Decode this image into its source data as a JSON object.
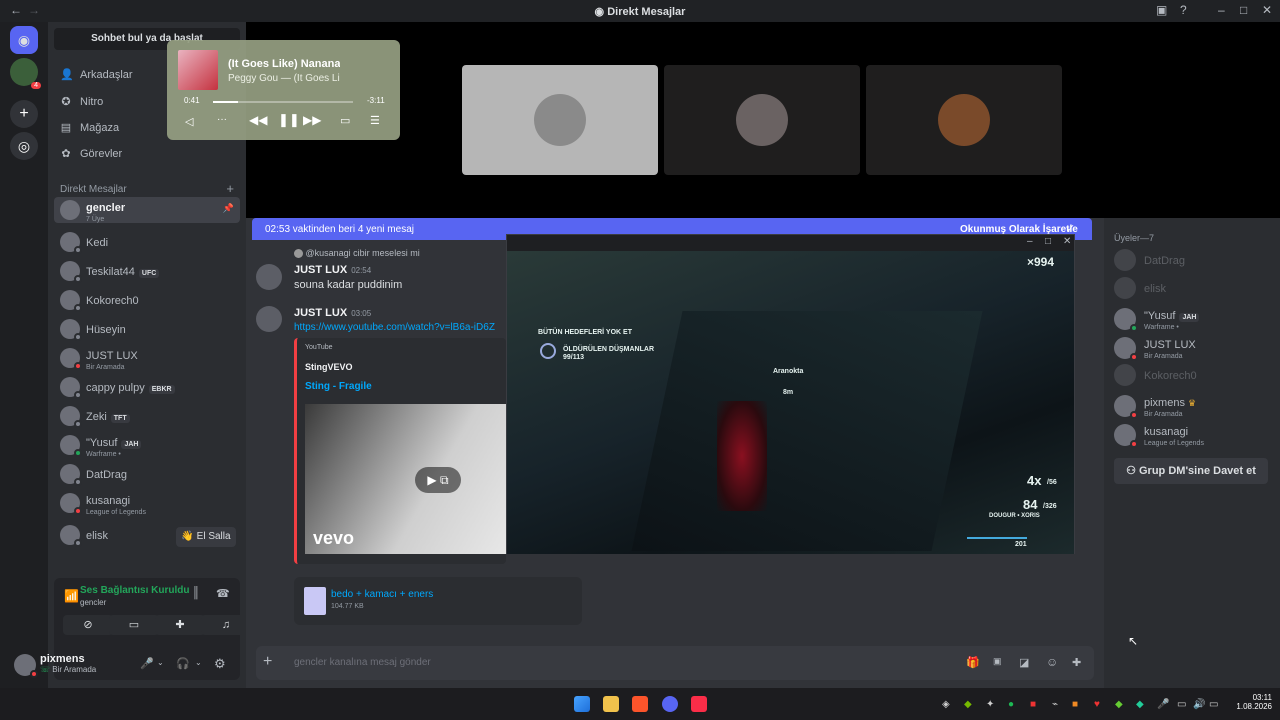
{
  "window": {
    "title": "Direkt Mesajlar"
  },
  "sidebar": {
    "search": "Sohbet bul ya da başlat",
    "nav": [
      {
        "label": "Arkadaşlar",
        "icon": "friends-icon"
      },
      {
        "label": "Nitro",
        "icon": "nitro-icon"
      },
      {
        "label": "Mağaza",
        "icon": "shop-icon"
      },
      {
        "label": "Görevler",
        "icon": "quests-icon"
      }
    ],
    "dm_header": "Direkt Mesajlar",
    "dms": [
      {
        "name": "gencler",
        "sub": "7 Üye",
        "status": "none",
        "selected": true
      },
      {
        "name": "Kedi",
        "sub": "",
        "status": "offline"
      },
      {
        "name": "Teskilat44",
        "sub": "",
        "status": "offline",
        "tag": "UFC"
      },
      {
        "name": "Kokorech0",
        "sub": "",
        "status": "offline"
      },
      {
        "name": "Hüseyin",
        "sub": "",
        "status": "offline"
      },
      {
        "name": "JUST LUX",
        "sub": "Bir Aramada",
        "status": "dnd"
      },
      {
        "name": "cappy pulpy",
        "sub": "",
        "status": "offline",
        "tag": "EBKR"
      },
      {
        "name": "Zeki",
        "sub": "",
        "status": "offline",
        "tag": "TFT"
      },
      {
        "name": "\"Yusuf",
        "sub": "Warframe •",
        "status": "online",
        "tag": "JAH"
      },
      {
        "name": "DatDrag",
        "sub": "",
        "status": "offline"
      },
      {
        "name": "kusanagi",
        "sub": "League of Legends",
        "status": "dnd"
      },
      {
        "name": "elisk",
        "sub": "",
        "status": "offline"
      }
    ],
    "wave_button": "El Salla"
  },
  "music": {
    "title": "(It Goes Like) Nanana (E",
    "artist": "Peggy Gou — (It Goes Li",
    "elapsed": "0:41",
    "remaining": "-3:11",
    "progress": 0.18
  },
  "voice": {
    "status": "Ses Bağlantısı Kuruldu",
    "channel": "gencler"
  },
  "user": {
    "name": "pixmens",
    "status": "Bir Aramada"
  },
  "banner": {
    "left": "02:53 vaktinden beri 4 yeni mesaj",
    "right": "Okunmuş Olarak İşaretle"
  },
  "messages": {
    "reply": "@kusanagi cibir meselesi mi",
    "m1": {
      "author": "JUST LUX",
      "time": "02:54",
      "text": "souna kadar puddinim"
    },
    "m2": {
      "author": "JUST LUX",
      "time": "03:05",
      "link": "https://www.youtube.com/watch?v=lB6a-iD6Z"
    },
    "embed": {
      "provider": "YouTube",
      "channel": "StingVEVO",
      "title": "Sting - Fragile",
      "brand": "vevo"
    },
    "attachment": {
      "name": "bedo + kamacı + eners",
      "size": "104.77 KB"
    }
  },
  "input": {
    "placeholder": "gencler kanalına mesaj gönder"
  },
  "members": {
    "header": "Üyeler—7",
    "list": [
      {
        "name": "DatDrag",
        "sub": "",
        "status": "offline",
        "offline": true
      },
      {
        "name": "elisk",
        "sub": "",
        "status": "offline",
        "offline": true
      },
      {
        "name": "\"Yusuf",
        "sub": "Warframe •",
        "status": "online",
        "tag": "JAH"
      },
      {
        "name": "JUST LUX",
        "sub": "Bir Aramada",
        "status": "dnd"
      },
      {
        "name": "Kokorech0",
        "sub": "",
        "status": "offline",
        "offline": true
      },
      {
        "name": "pixmens",
        "sub": "Bir Aramada",
        "status": "dnd",
        "crown": "♛"
      },
      {
        "name": "kusanagi",
        "sub": "League of Legends",
        "status": "dnd"
      }
    ],
    "invite": "Grup DM'sine Davet et"
  },
  "game": {
    "objective": "BÜTÜN HEDEFLERİ YOK ET",
    "killed": "ÖLDÜRÜLEN DÜŞMANLAR",
    "killed_count": "99/113",
    "marker": "Aranokta",
    "marker_dist": "8m",
    "score": "×994",
    "multiplier": "4x",
    "mult_sub": "/56",
    "ammo": "84",
    "ammo_sub": "/326",
    "ammo_label": "DOUGUR • XORIS",
    "energy": "201"
  },
  "clock": {
    "time": "03:11",
    "date": "1.08.2026"
  }
}
